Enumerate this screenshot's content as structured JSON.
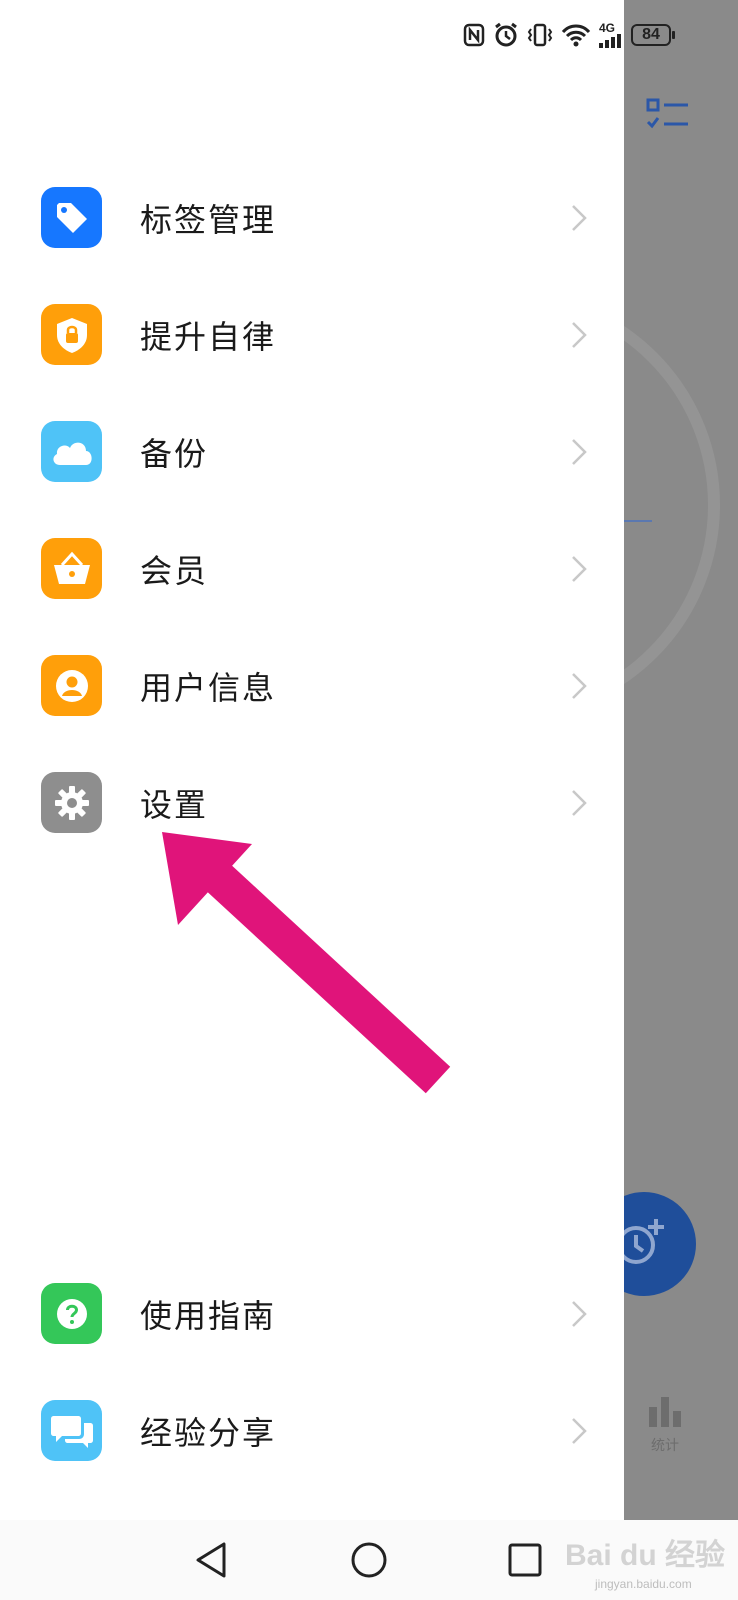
{
  "status_bar": {
    "network": "4G",
    "battery": "84"
  },
  "menu": {
    "items": [
      {
        "label": "标签管理",
        "icon": "tag-icon",
        "color": "#1677ff"
      },
      {
        "label": "提升自律",
        "icon": "shield-lock-icon",
        "color": "#ff9f0a"
      },
      {
        "label": "备份",
        "icon": "cloud-icon",
        "color": "#4fc3f7"
      },
      {
        "label": "会员",
        "icon": "basket-icon",
        "color": "#ff9f0a"
      },
      {
        "label": "用户信息",
        "icon": "user-icon",
        "color": "#ff9f0a"
      },
      {
        "label": "设置",
        "icon": "gear-icon",
        "color": "#8e8e8e"
      }
    ],
    "bottom_items": [
      {
        "label": "使用指南",
        "icon": "help-icon",
        "color": "#34c759"
      },
      {
        "label": "经验分享",
        "icon": "chat-icon",
        "color": "#4fc3f7"
      }
    ]
  },
  "background_app": {
    "stats_label": "统计",
    "accent": "#1f4e9a"
  },
  "annotation": {
    "arrow_color": "#e0147a"
  },
  "watermark": {
    "brand": "Bai du 经验",
    "url": "jingyan.baidu.com"
  }
}
